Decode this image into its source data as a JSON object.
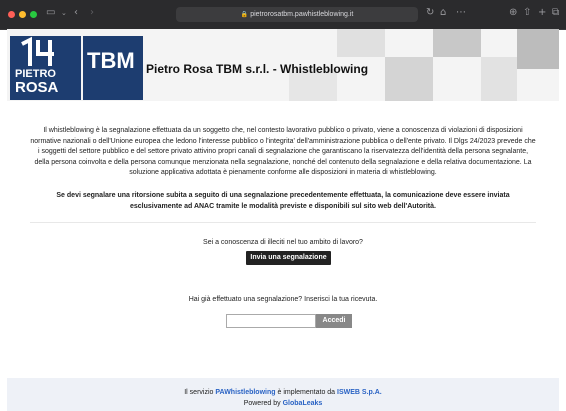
{
  "browser": {
    "url": "pietrorosatbm.pawhistleblowing.it",
    "traffic_lights": [
      "#ff5f57",
      "#febc2e",
      "#28c840"
    ],
    "icons": [
      "sidebar-icon",
      "chevron-down-icon",
      "back-icon",
      "forward-icon",
      "reload-icon",
      "home-icon",
      "grid-icon",
      "download-icon",
      "share-icon",
      "new-tab-icon",
      "tabs-icon"
    ]
  },
  "header": {
    "logo_pietro": "PIETRO",
    "logo_rosa": "ROSA",
    "logo_tbm": "TBM",
    "title": "Pietro Rosa TBM s.r.l. - Whistleblowing"
  },
  "main": {
    "intro": "Il whistleblowing è la segnalazione effettuata da un soggetto che, nel contesto lavorativo pubblico o privato, viene a conoscenza di violazioni di disposizioni normative nazionali o dell'Unione europea che ledono l'interesse pubblico o l'integrita' dell'amministrazione pubblica o dell'ente privato. Il Dlgs 24/2023 prevede che i soggetti del settore pubblico e del settore privato attivino propri canali di segnalazione che garantiscano la riservatezza dell'identità della persona segnalante, della persona coinvolta e della persona comunque menzionata nella segnalazione, nonché del contenuto della segnalazione e della relativa documentazione. La soluzione applicativa adottata è pienamente conforme alle disposizioni in materia di whistleblowing.",
    "warning": "Se devi segnalare una ritorsione subita a seguito di una segnalazione precedentemente effettuata, la comunicazione deve essere inviata esclusivamente ad ANAC tramite le modalità previste e disponibili sul sito web dell'Autorità.",
    "question1": "Sei a conoscenza di illeciti nel tuo ambito di lavoro?",
    "submit_label": "Invia una segnalazione",
    "question2": "Hai già effettuato una segnalazione? Inserisci la tua ricevuta.",
    "receipt_value": "",
    "receipt_placeholder": "",
    "login_label": "Accedi"
  },
  "footer": {
    "line1_prefix": "Il servizio",
    "line1_product": "PAWhistleblowing",
    "line1_middle": "è implementato da",
    "line1_company": "ISWEB S.p.A.",
    "line2_prefix": "Powered by",
    "line2_brand": "GlobaLeaks"
  },
  "colors": {
    "brand_navy": "#1d3d70",
    "link": "#2a63c4",
    "primary_button": "#222222",
    "disabled_button": "#888888"
  }
}
